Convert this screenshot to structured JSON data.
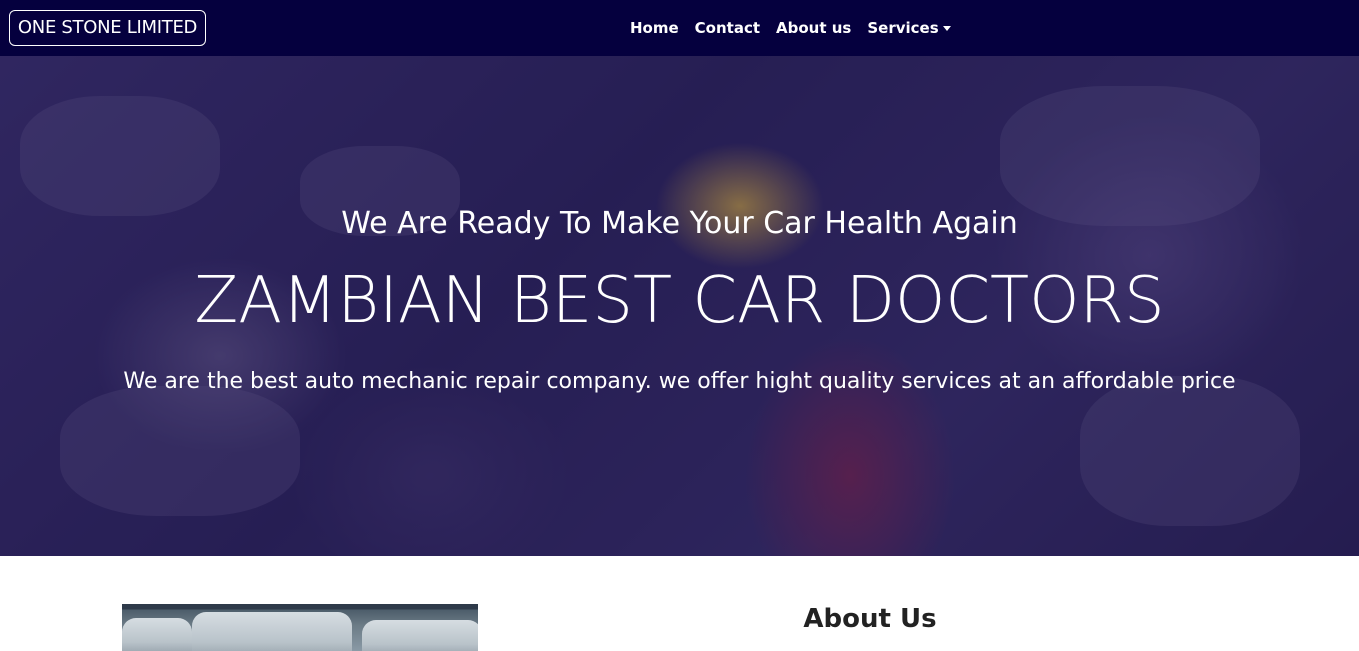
{
  "navbar": {
    "brand": "ONE STONE LIMITED",
    "links": [
      {
        "label": "Home"
      },
      {
        "label": "Contact"
      },
      {
        "label": "About us"
      },
      {
        "label": "Services"
      }
    ],
    "background": "#05003e"
  },
  "hero": {
    "tagline": "We Are Ready To Make Your Car Health Again",
    "title": "ZAMBIAN BEST CAR DOCTORS",
    "description": "We are the best auto mechanic repair company. we offer hight quality services at an affordable price",
    "overlay_color": "#2a2060"
  },
  "about": {
    "title": "About Us"
  }
}
